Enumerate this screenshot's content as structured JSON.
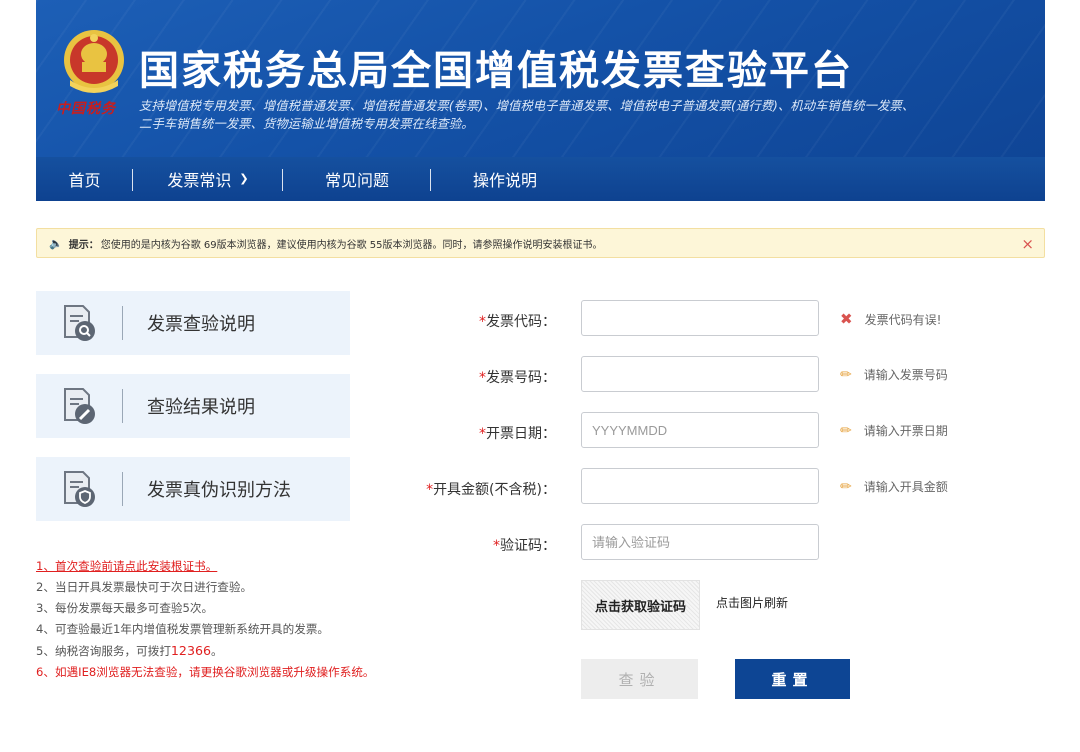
{
  "header": {
    "title": "国家税务总局全国增值税发票查验平台",
    "subtitle_line1": "支持增值税专用发票、增值税普通发票、增值税普通发票(卷票)、增值税电子普通发票、增值税电子普通发票(通行费)、机动车销售统一发票、",
    "subtitle_line2": "二手车销售统一发票、货物运输业增值税专用发票在线查验。",
    "emblem_text": "中国税务"
  },
  "nav": {
    "items": [
      {
        "label": "首页"
      },
      {
        "label": "发票常识"
      },
      {
        "label": "常见问题"
      },
      {
        "label": "操作说明"
      }
    ]
  },
  "tip": {
    "label": "提示：",
    "text": "您使用的是内核为谷歌 69版本浏览器，建议使用内核为谷歌 55版本浏览器。同时，请参照操作说明安装根证书。",
    "close": "×"
  },
  "cards": [
    {
      "label": "发票查验说明",
      "icon": "document-search-icon"
    },
    {
      "label": "查验结果说明",
      "icon": "document-edit-icon"
    },
    {
      "label": "发票真伪识别方法",
      "icon": "document-shield-icon"
    }
  ],
  "notes": {
    "n1": "1、首次查验前请点此安装根证书。",
    "n2": "2、当日开具发票最快可于次日进行查验。",
    "n3": "3、每份发票每天最多可查验5次。",
    "n4": "4、可查验最近1年内增值税发票管理新系统开具的发票。",
    "n5_prefix": "5、纳税咨询服务，可拨打",
    "n5_phone": "12366",
    "n5_suffix": "。",
    "n6": "6、如遇IE8浏览器无法查验，请更换谷歌浏览器或升级操作系统。"
  },
  "form": {
    "required_mark": "*",
    "code_label": "发票代码：",
    "code_value": "",
    "code_hint": "发票代码有误!",
    "number_label": "发票号码：",
    "number_value": "",
    "number_hint": "请输入发票号码",
    "date_label": "开票日期：",
    "date_placeholder": "YYYYMMDD",
    "date_hint": "请输入开票日期",
    "amount_label": "开具金额(不含税)：",
    "amount_value": "",
    "amount_hint": "请输入开具金额",
    "captcha_label": "验证码：",
    "captcha_placeholder": "请输入验证码",
    "captcha_image_text": "点击获取验证码",
    "captcha_refresh": "点击图片刷新",
    "check_button": "查验",
    "reset_button": "重置"
  },
  "colors": {
    "header_blue": "#1452a8",
    "nav_blue": "#0e4290",
    "required_red": "#e02020",
    "tip_bg": "#fdf6d8",
    "reset_btn": "#0d4594"
  }
}
